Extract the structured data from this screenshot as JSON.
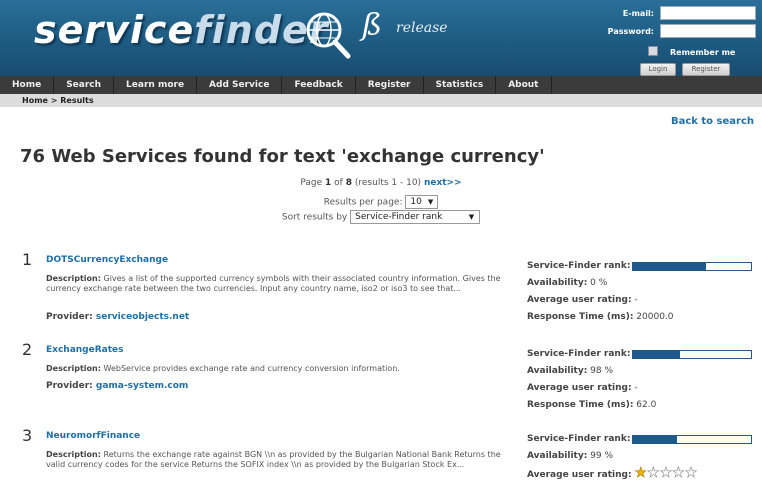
{
  "header": {
    "logo_service": "service",
    "logo_finder": "finder",
    "beta_symbol": "ß",
    "release": "release"
  },
  "login": {
    "email_label": "E-mail:",
    "password_label": "Password:",
    "email_value": "",
    "password_value": "",
    "remember_label": "Remember me",
    "login_button": "Login",
    "register_button": "Register"
  },
  "nav": [
    "Home",
    "Search",
    "Learn more",
    "Add Service",
    "Feedback",
    "Register",
    "Statistics",
    "About"
  ],
  "breadcrumb": {
    "home": "Home",
    "sep": ">",
    "current": "Results"
  },
  "back_link": "Back to search",
  "results_title": "76 Web Services found for text 'exchange currency'",
  "pagination": {
    "prefix": "Page",
    "current": "1",
    "of": "of",
    "total": "8",
    "range": "(results 1 - 10)",
    "next": "next>>"
  },
  "per_page": {
    "label": "Results per page:",
    "value": "10"
  },
  "sort": {
    "label": "Sort results by",
    "value": "Service-Finder rank"
  },
  "meta_labels": {
    "rank": "Service-Finder rank:",
    "availability": "Availability:",
    "rating": "Average user rating:",
    "response": "Response Time (ms):"
  },
  "results": [
    {
      "num": "1",
      "name": "DOTSCurrencyExchange",
      "description_label": "Description:",
      "description": "Gives a list of the supported currency symbols with their associated country information. Gives the currency exchange rate between the two currencies. Input any country name, iso2 or iso3 to see that...",
      "provider_label": "Provider:",
      "provider": "serviceobjects.net",
      "rank_fraction": 0.62,
      "availability": "0 %",
      "rating": "-",
      "response_time": "20000.0"
    },
    {
      "num": "2",
      "name": "ExchangeRates",
      "description_label": "Description:",
      "description": "WebService provides exchange rate and currency conversion information.",
      "provider_label": "Provider:",
      "provider": "gama-system.com",
      "rank_fraction": 0.4,
      "availability": "98 %",
      "rating": "-",
      "response_time": "62.0"
    },
    {
      "num": "3",
      "name": "NeuromorfFinance",
      "description_label": "Description:",
      "description": "Returns the exchange rate against BGN \\\\n as provided by the Bulgarian National Bank Returns the valid currency codes for the service Returns the SOFIX index \\\\n as provided by the Bulgarian Stock Ex...",
      "rank_fraction": 0.37,
      "availability": "99 %",
      "rating_stars": 1,
      "rating_max": 5
    }
  ]
}
